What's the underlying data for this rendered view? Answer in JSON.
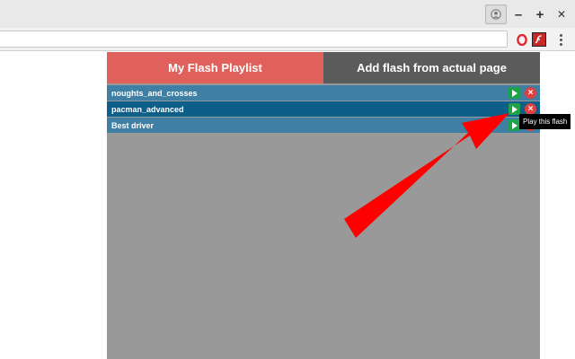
{
  "window": {
    "minimize_label": "–",
    "maximize_label": "+",
    "close_label": "✕"
  },
  "toolbar": {
    "address_value": "",
    "menu_icon": "kebab-menu-icon",
    "opera_icon": "opera-icon",
    "flash_extension_icon": "flash-playlist-extension-icon"
  },
  "popup": {
    "tabs": [
      {
        "label": "My Flash Playlist"
      },
      {
        "label": "Add flash from actual page"
      }
    ],
    "playlist": [
      {
        "name": "noughts_and_crosses"
      },
      {
        "name": "pacman_advanced"
      },
      {
        "name": "Best driver"
      }
    ],
    "tooltip": "Play this flash"
  },
  "colors": {
    "active_tab": "#e0615b",
    "inactive_tab": "#5b5b5b",
    "row": "#3f7fa3",
    "row_selected": "#0d5f8a",
    "play": "#1ea24a",
    "remove": "#e04040",
    "arrow": "#ff0000"
  }
}
